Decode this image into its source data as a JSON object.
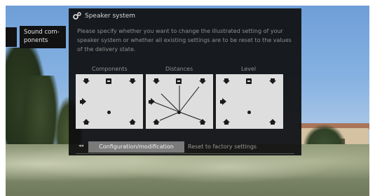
{
  "sidebar": {
    "tab_label": "Sound com-\nponents"
  },
  "dialog": {
    "title": "Speaker system",
    "text": "Please specify whether you want to change the illustrated setting of your speaker system or whether all existing settings are to be reset to the values of the delivery state.",
    "columns": [
      "Components",
      "Distances",
      "Level"
    ],
    "buttons": {
      "nav": "◂◂",
      "configuration": "Configuration/modification",
      "reset": "Reset to factory settings"
    }
  },
  "icons": {
    "title_icon": "gear-icon",
    "front_speaker": "speaker-icon",
    "center_speaker": "center-speaker-icon",
    "rear_speaker": "rear-speaker-icon",
    "subwoofer": "subwoofer-icon",
    "listener": "listener-position-icon"
  },
  "colors": {
    "dialog_bg": "#0e0e0e",
    "panel_bg": "#dedede",
    "selected_button": "#7a7a7a"
  }
}
